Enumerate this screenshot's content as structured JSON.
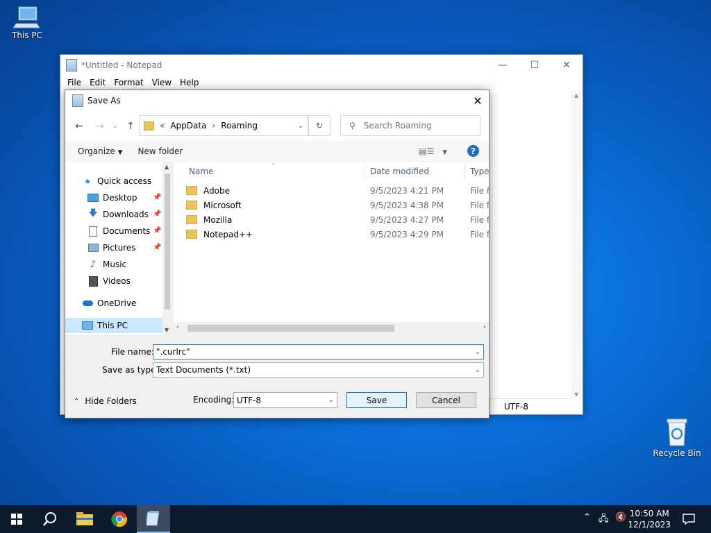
{
  "desktop": {
    "this_pc_label": "This PC",
    "recycle_bin_label": "Recycle Bin"
  },
  "notepad": {
    "title": "*Untitled - Notepad",
    "menu": [
      "File",
      "Edit",
      "Format",
      "View",
      "Help"
    ],
    "status_encoding": "UTF-8"
  },
  "dialog": {
    "title": "Save As",
    "breadcrumb": [
      "AppData",
      "Roaming"
    ],
    "breadcrumb_prefix": "«",
    "search_placeholder": "Search Roaming",
    "toolbar": {
      "organize": "Organize",
      "new_folder": "New folder"
    },
    "tree": [
      {
        "label": "Quick access",
        "icon": "star-icon",
        "pinned": false
      },
      {
        "label": "Desktop",
        "icon": "desktop-icon",
        "pinned": true
      },
      {
        "label": "Downloads",
        "icon": "download-arrow-icon",
        "pinned": true
      },
      {
        "label": "Documents",
        "icon": "document-icon",
        "pinned": true
      },
      {
        "label": "Pictures",
        "icon": "picture-icon",
        "pinned": true
      },
      {
        "label": "Music",
        "icon": "music-note-icon",
        "pinned": false
      },
      {
        "label": "Videos",
        "icon": "film-icon",
        "pinned": false
      },
      {
        "label": "OneDrive",
        "icon": "cloud-icon",
        "pinned": false
      },
      {
        "label": "This PC",
        "icon": "computer-icon",
        "pinned": false
      }
    ],
    "columns": {
      "name": "Name",
      "date": "Date modified",
      "type": "Type"
    },
    "files": [
      {
        "name": "Adobe",
        "date": "9/5/2023 4:21 PM",
        "type": "File folder"
      },
      {
        "name": "Microsoft",
        "date": "9/5/2023 4:38 PM",
        "type": "File folder"
      },
      {
        "name": "Mozilla",
        "date": "9/5/2023 4:27 PM",
        "type": "File folder"
      },
      {
        "name": "Notepad++",
        "date": "9/5/2023 4:29 PM",
        "type": "File folder"
      }
    ],
    "file_name_label": "File name:",
    "file_name_value": "\".curlrc\"",
    "save_type_label": "Save as type:",
    "save_type_value": "Text Documents (*.txt)",
    "encoding_label": "Encoding:",
    "encoding_value": "UTF-8",
    "save_button": "Save",
    "cancel_button": "Cancel",
    "hide_folders": "Hide Folders"
  },
  "taskbar": {
    "time": "10:50 AM",
    "date": "12/1/2023"
  }
}
